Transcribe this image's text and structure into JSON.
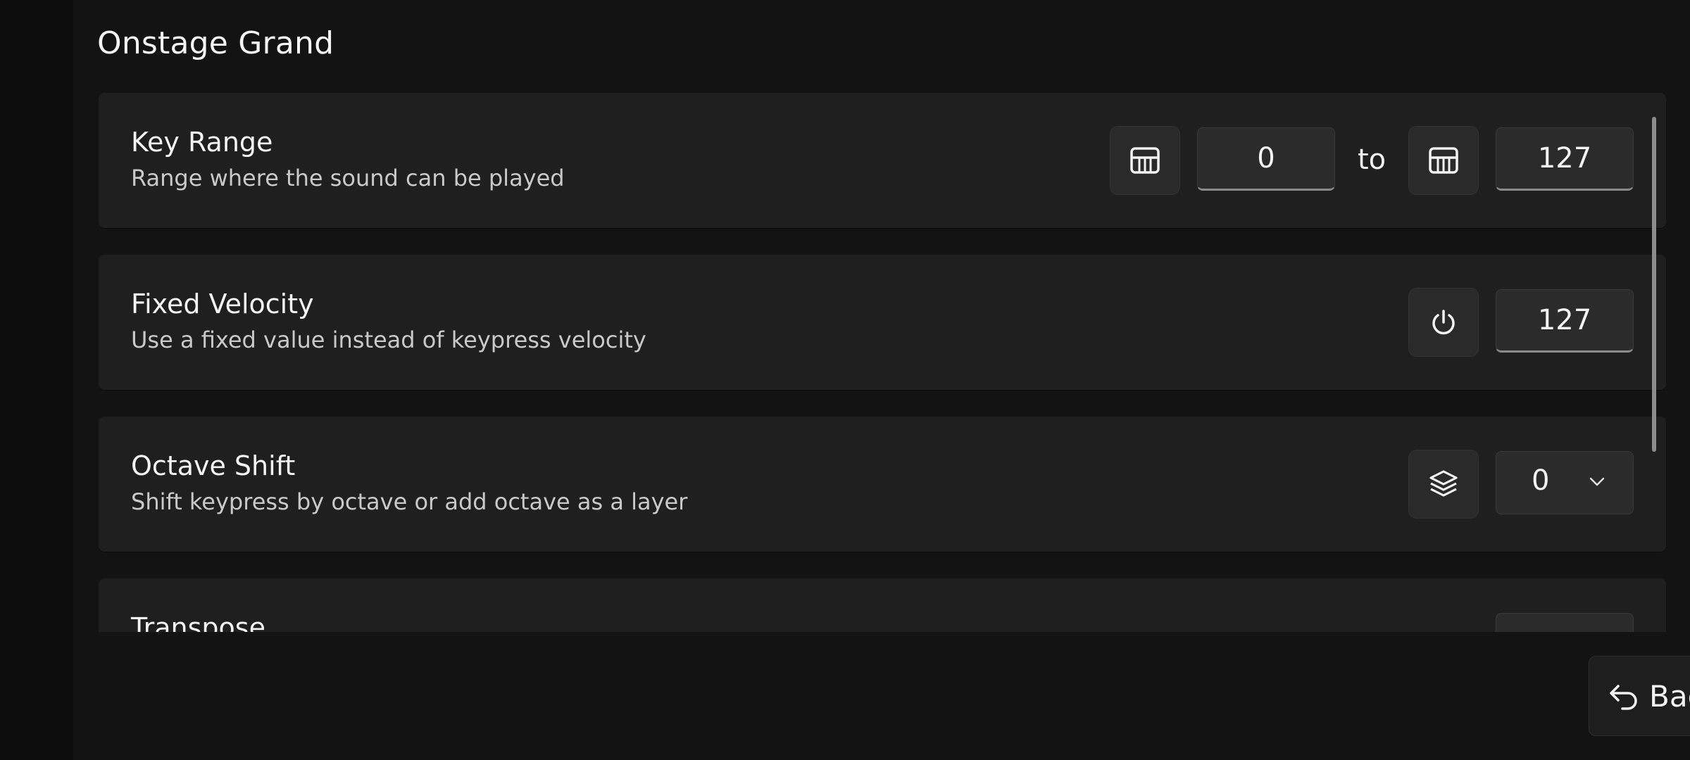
{
  "page": {
    "title": "Onstage Grand"
  },
  "key_range": {
    "title": "Key Range",
    "description": "Range where the sound can be played",
    "from_icon": "piano-keys-icon",
    "from_value": "0",
    "to_label": "to",
    "to_icon": "piano-keys-icon",
    "to_value": "127"
  },
  "fixed_velocity": {
    "title": "Fixed Velocity",
    "description": "Use a fixed value instead of keypress velocity",
    "toggle_icon": "power-icon",
    "value": "127"
  },
  "octave_shift": {
    "title": "Octave Shift",
    "description": "Shift keypress by octave or add octave as a layer",
    "layer_icon": "layers-icon",
    "selected": "0",
    "chevron_icon": "chevron-down-icon"
  },
  "transpose": {
    "title": "Transpose"
  },
  "footer": {
    "back_label": "Back",
    "back_icon": "undo-arrow-icon"
  },
  "colors": {
    "background": "#111111",
    "card": "#1f1f1f",
    "control": "#2b2b2b",
    "text": "#f4f4f4",
    "secondary_text": "#c9c9c9"
  }
}
